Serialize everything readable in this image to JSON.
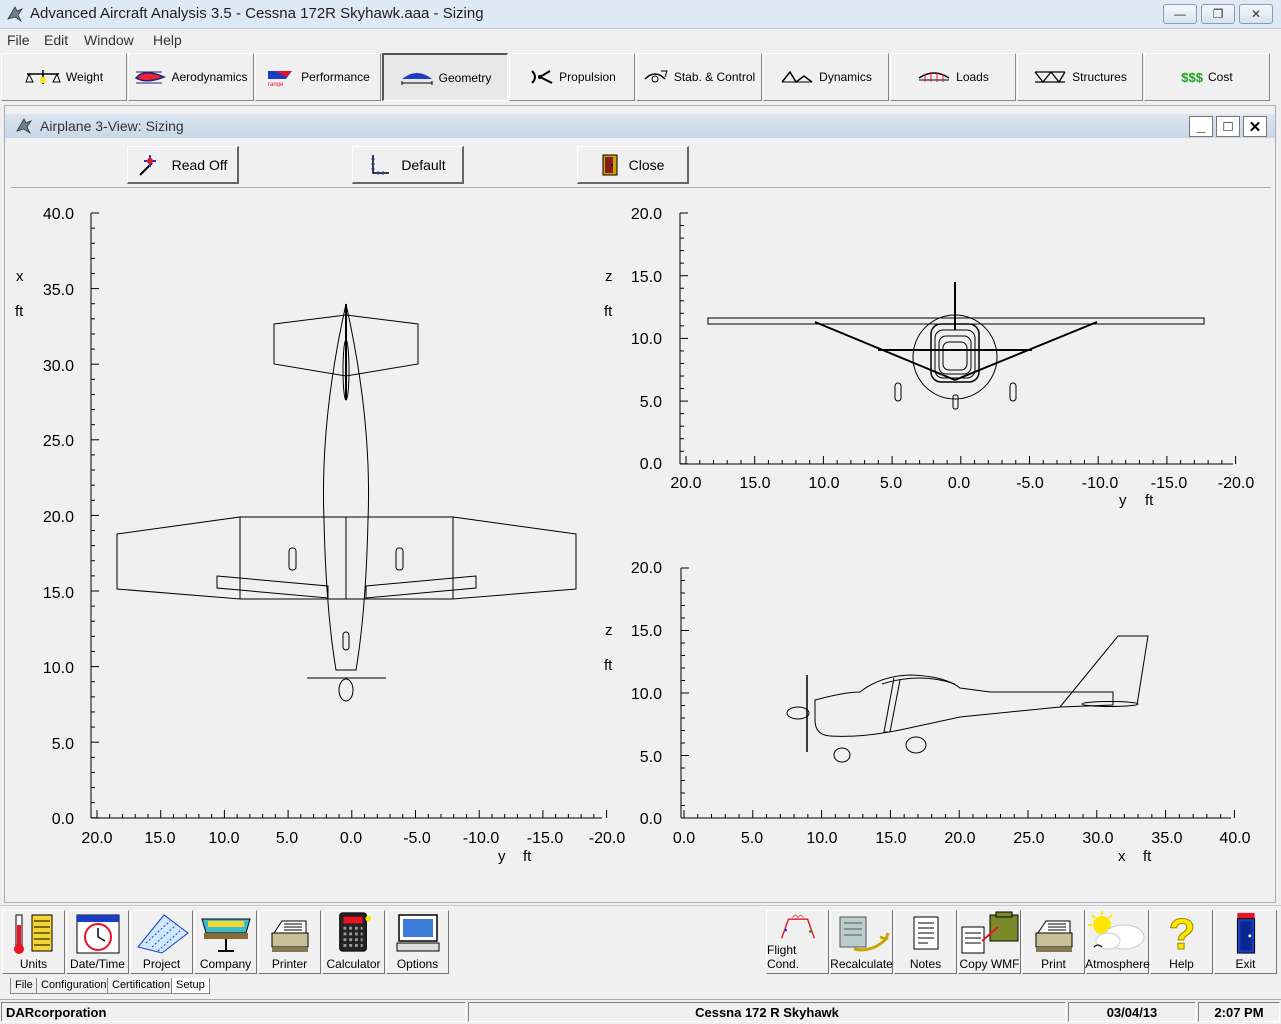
{
  "window": {
    "title": "Advanced Aircraft Analysis 3.5 - Cessna 172R Skyhawk.aaa - Sizing",
    "minimize": "—",
    "restore": "❐",
    "close": "✕"
  },
  "menu": [
    "File",
    "Edit",
    "Window",
    "Help"
  ],
  "toolbar": [
    {
      "label": "Weight",
      "icon": "scale-icon"
    },
    {
      "label": "Aerodynamics",
      "icon": "airfoil-icon"
    },
    {
      "label": "Performance",
      "icon": "performance-icon"
    },
    {
      "label": "Geometry",
      "icon": "geometry-icon",
      "active": true
    },
    {
      "label": "Propulsion",
      "icon": "propeller-icon"
    },
    {
      "label": "Stab. & Control",
      "icon": "stability-icon"
    },
    {
      "label": "Dynamics",
      "icon": "dynamics-icon"
    },
    {
      "label": "Loads",
      "icon": "loads-icon"
    },
    {
      "label": "Structures",
      "icon": "structures-icon"
    },
    {
      "label": "Cost",
      "icon": "dollar-icon",
      "icon_text": "$$$"
    }
  ],
  "child_window": {
    "title": "Airplane 3-View: Sizing",
    "minimize": "_",
    "maximize": "□",
    "close": "✕",
    "buttons": {
      "read_off": "Read Off",
      "default": "Default",
      "close": "Close"
    }
  },
  "plots": {
    "top_view": {
      "ylabel": "x",
      "yunit": "ft",
      "xlabel": "y",
      "xunit": "ft",
      "yticks": [
        "40.0",
        "35.0",
        "30.0",
        "25.0",
        "20.0",
        "15.0",
        "10.0",
        "5.0",
        "0.0"
      ],
      "xticks": [
        "20.0",
        "15.0",
        "10.0",
        "5.0",
        "0.0",
        "-5.0",
        "-10.0",
        "-15.0",
        "-20.0"
      ]
    },
    "front_view": {
      "ylabel": "z",
      "yunit": "ft",
      "xlabel": "y",
      "xunit": "ft",
      "yticks": [
        "20.0",
        "15.0",
        "10.0",
        "5.0",
        "0.0"
      ],
      "xticks": [
        "20.0",
        "15.0",
        "10.0",
        "5.0",
        "0.0",
        "-5.0",
        "-10.0",
        "-15.0",
        "-20.0"
      ]
    },
    "side_view": {
      "ylabel": "z",
      "yunit": "ft",
      "xlabel": "x",
      "xunit": "ft",
      "yticks": [
        "20.0",
        "15.0",
        "10.0",
        "5.0",
        "0.0"
      ],
      "xticks": [
        "0.0",
        "5.0",
        "10.0",
        "15.0",
        "20.0",
        "25.0",
        "30.0",
        "35.0",
        "40.0"
      ]
    }
  },
  "bottom_left": [
    {
      "label": "Units",
      "icon": "thermometer-icon"
    },
    {
      "label": "Date/Time",
      "icon": "clock-calendar-icon"
    },
    {
      "label": "Project",
      "icon": "project-icon"
    },
    {
      "label": "Company",
      "icon": "company-icon"
    },
    {
      "label": "Printer",
      "icon": "printer-icon"
    },
    {
      "label": "Calculator",
      "icon": "calculator-icon"
    },
    {
      "label": "Options",
      "icon": "monitor-icon"
    }
  ],
  "bottom_right": [
    {
      "label": "Flight Cond.",
      "icon": "flight-condition-icon"
    },
    {
      "label": "Recalculate",
      "icon": "recalculate-icon"
    },
    {
      "label": "Notes",
      "icon": "notes-icon"
    },
    {
      "label": "Copy WMF",
      "icon": "copy-icon"
    },
    {
      "label": "Print",
      "icon": "print-icon"
    },
    {
      "label": "Atmosphere",
      "icon": "atmosphere-icon"
    },
    {
      "label": "Help",
      "icon": "help-icon"
    },
    {
      "label": "Exit",
      "icon": "exit-door-icon"
    }
  ],
  "tabs": [
    "File",
    "Configuration",
    "Certification",
    "Setup"
  ],
  "statusbar": {
    "company": "DARcorporation",
    "project": "Cessna 172 R Skyhawk",
    "date": "03/04/13",
    "time": "2:07 PM"
  }
}
